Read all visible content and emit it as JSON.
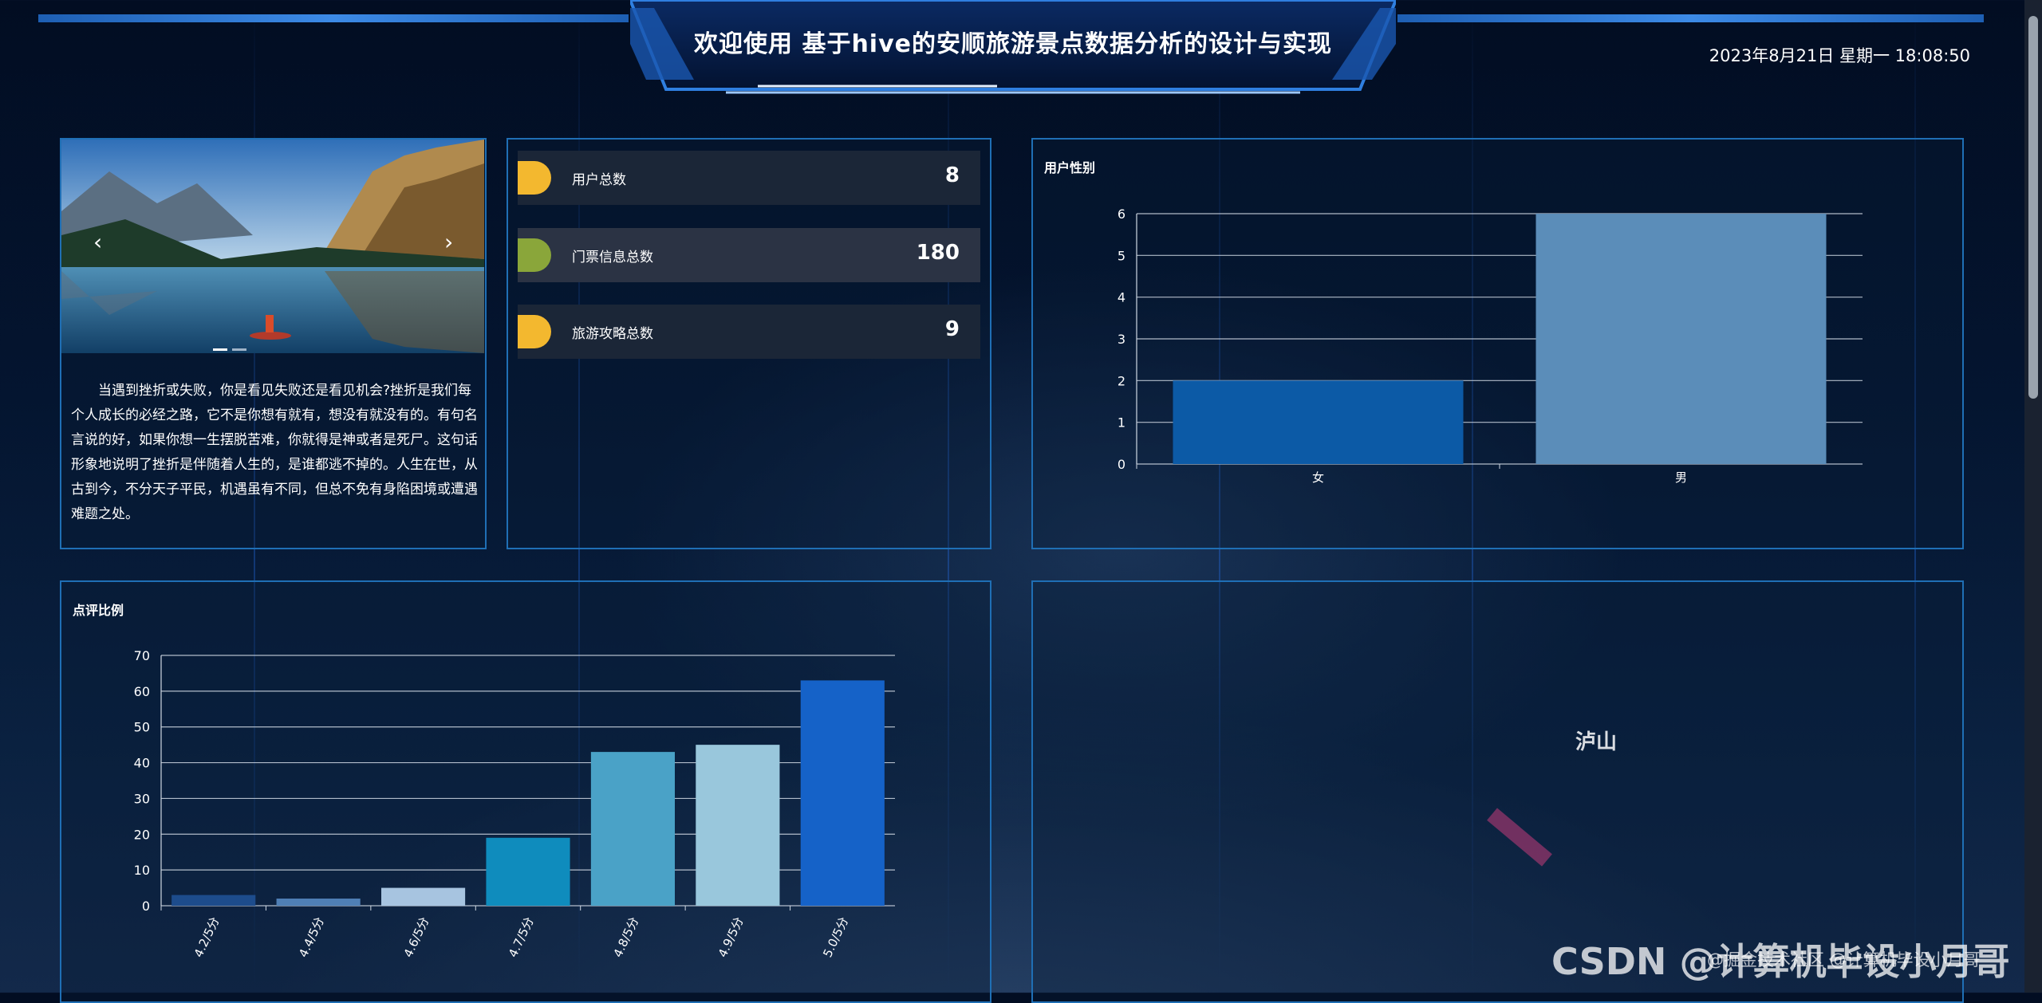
{
  "header": {
    "title": "欢迎使用 基于hive的安顺旅游景点数据分析的设计与实现",
    "datetime": "2023年8月21日 星期一 18:08:50"
  },
  "carousel": {
    "prev": "‹",
    "next": "›",
    "paragraph": "当遇到挫折或失败，你是看见失败还是看见机会?挫折是我们每个人成长的必经之路，它不是你想有就有，想没有就没有的。有句名言说的好，如果你想一生摆脱苦难，你就得是神或者是死尸。这句话形象地说明了挫折是伴随着人生的，是谁都逃不掉的。人生在世，从古到今，不分天子平民，机遇虽有不同，但总不免有身陷困境或遭遇难题之处。"
  },
  "stats": [
    {
      "label": "用户总数",
      "value": "8",
      "color": "#f3b82f"
    },
    {
      "label": "门票信息总数",
      "value": "180",
      "color": "#8aa63a"
    },
    {
      "label": "旅游攻略总数",
      "value": "9",
      "color": "#f3b82f"
    }
  ],
  "gender_chart": {
    "title": "用户性别",
    "chart_data": {
      "type": "bar",
      "categories": [
        "女",
        "男"
      ],
      "values": [
        2,
        6
      ],
      "ylim": [
        0,
        6
      ],
      "yticks": [
        0,
        1,
        2,
        3,
        4,
        5,
        6
      ],
      "colors": [
        "#0c5aa6",
        "#5b8db9"
      ],
      "grid": true
    }
  },
  "rating_chart": {
    "title": "点评比例",
    "chart_data": {
      "type": "bar",
      "categories": [
        "4.2/5分",
        "4.4/5分",
        "4.6/5分",
        "4.7/5分",
        "4.8/5分",
        "4.9/5分",
        "5.0/5分"
      ],
      "values": [
        3,
        2,
        5,
        19,
        43,
        45,
        63
      ],
      "ylim": [
        0,
        70
      ],
      "yticks": [
        0,
        10,
        20,
        30,
        40,
        50,
        60,
        70
      ],
      "colors": [
        "#1d4c8c",
        "#4f7fb5",
        "#a7c4e0",
        "#0f8cbd",
        "#4aa2c7",
        "#99c7dc",
        "#1562c8"
      ],
      "grid": true
    }
  },
  "wordcloud": {
    "words": [
      {
        "text": "泸山",
        "color": "#c9a13a"
      },
      {
        "text": "",
        "color": "#c43c7a"
      }
    ]
  },
  "watermark": "CSDN @计算机毕设小月哥",
  "watermark2": "@掘金技术社区 @计算机毕设小月哥"
}
